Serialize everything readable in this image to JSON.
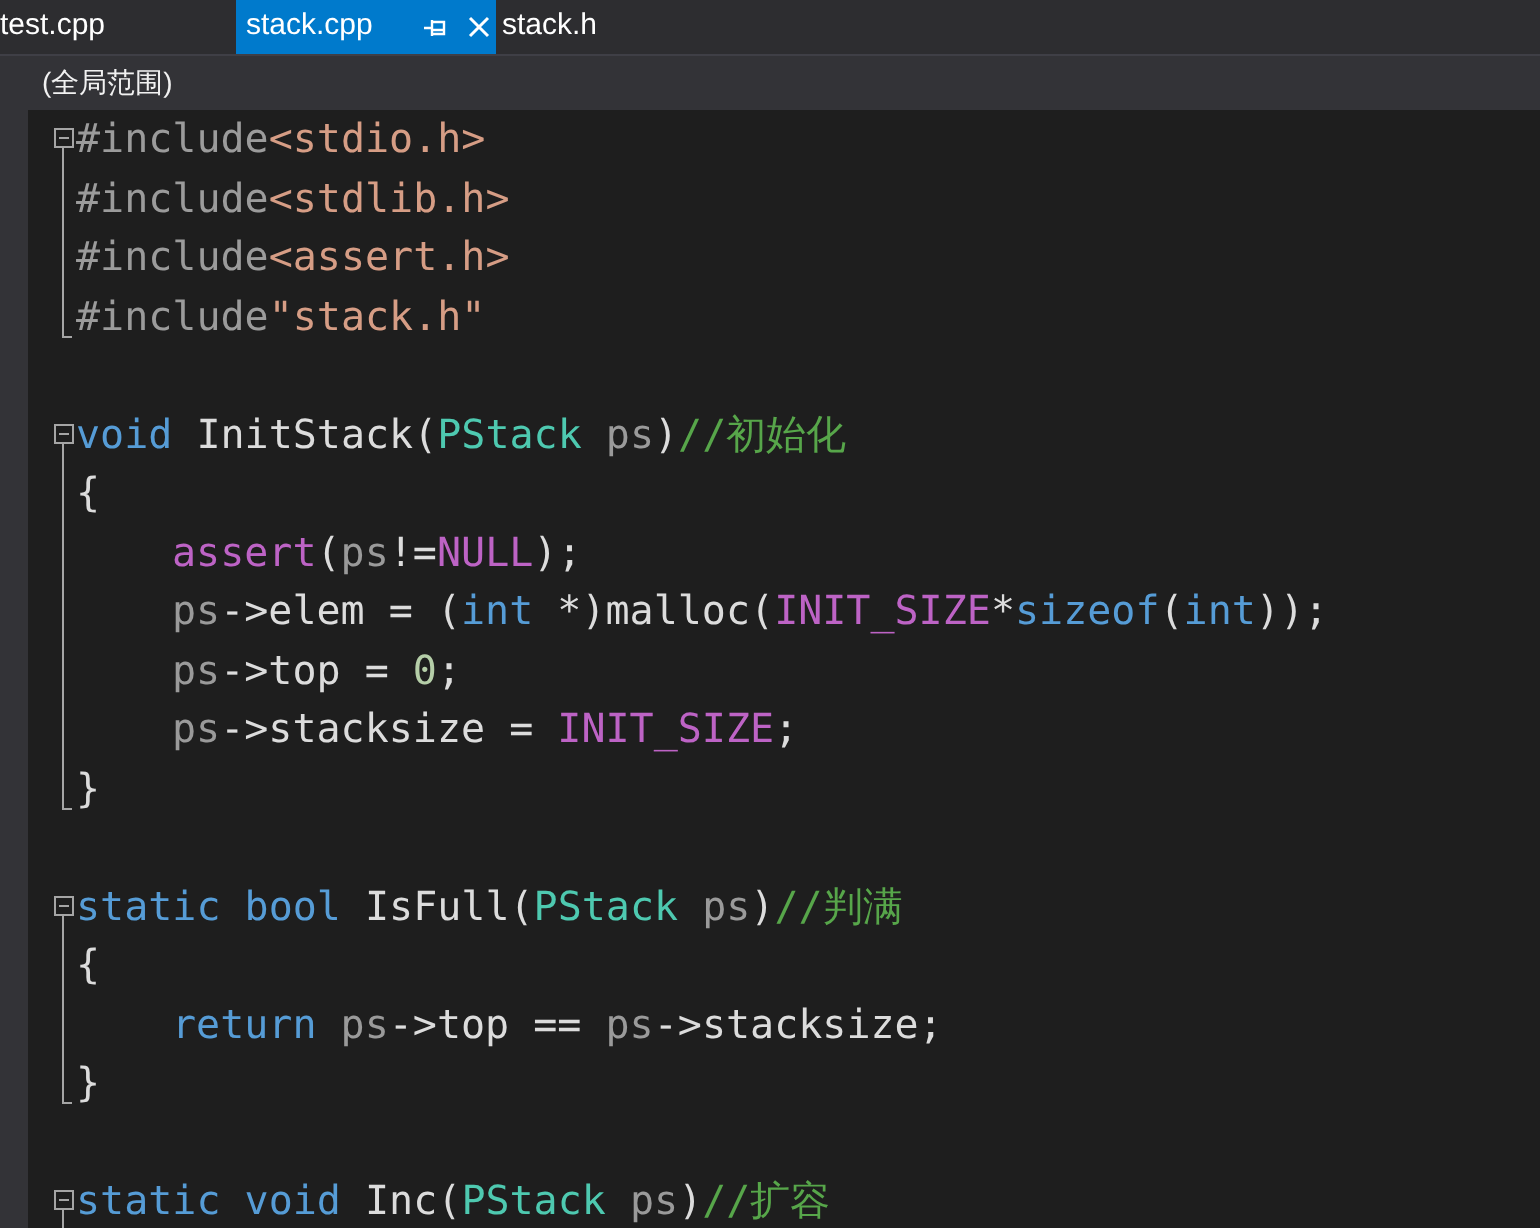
{
  "tabs": [
    {
      "label": "test.cpp",
      "selected": false
    },
    {
      "label": "stack.cpp",
      "selected": true
    },
    {
      "label": "stack.h",
      "selected": false
    }
  ],
  "scope": "(全局范围)",
  "code": [
    {
      "kind": "start",
      "tokens": [
        {
          "text": "#include",
          "kind": "pre"
        },
        {
          "text": "<stdio.h>",
          "kind": "str"
        }
      ]
    },
    {
      "kind": "inside",
      "tokens": [
        {
          "text": "#include",
          "kind": "pre"
        },
        {
          "text": "<stdlib.h>",
          "kind": "str"
        }
      ]
    },
    {
      "kind": "inside",
      "tokens": [
        {
          "text": "#include",
          "kind": "pre"
        },
        {
          "text": "<assert.h>",
          "kind": "str"
        }
      ]
    },
    {
      "kind": "end",
      "tokens": [
        {
          "text": "#include",
          "kind": "pre"
        },
        {
          "text": "\"stack.h\"",
          "kind": "str"
        }
      ]
    },
    {
      "kind": "blank"
    },
    {
      "kind": "start",
      "tokens": [
        {
          "text": "void",
          "kind": "kw"
        },
        {
          "text": " InitStack(",
          "kind": "plain"
        },
        {
          "text": "PStack",
          "kind": "type"
        },
        {
          "text": " ps",
          "kind": "param"
        },
        {
          "text": ")",
          "kind": "plain"
        },
        {
          "text": "//初始化",
          "kind": "comment"
        }
      ]
    },
    {
      "kind": "inside",
      "tokens": [
        {
          "text": "{",
          "kind": "plain"
        }
      ],
      "children": [
        {
          "kind": "inside",
          "tokens": [
            {
              "text": "assert",
              "kind": "macro"
            },
            {
              "text": "(",
              "kind": "plain"
            },
            {
              "text": "ps",
              "kind": "param"
            },
            {
              "text": "!=",
              "kind": "plain"
            },
            {
              "text": "NULL",
              "kind": "macro"
            },
            {
              "text": ");",
              "kind": "plain"
            }
          ]
        },
        {
          "kind": "inside",
          "tokens": [
            {
              "text": "ps",
              "kind": "param"
            },
            {
              "text": "->elem = (",
              "kind": "plain"
            },
            {
              "text": "int",
              "kind": "kw"
            },
            {
              "text": " *)malloc(",
              "kind": "plain"
            },
            {
              "text": "INIT_SIZE",
              "kind": "macro"
            },
            {
              "text": "*",
              "kind": "plain"
            },
            {
              "text": "sizeof",
              "kind": "kw"
            },
            {
              "text": "(",
              "kind": "plain"
            },
            {
              "text": "int",
              "kind": "kw"
            },
            {
              "text": "));",
              "kind": "plain"
            }
          ]
        },
        {
          "kind": "inside",
          "tokens": [
            {
              "text": "ps",
              "kind": "param"
            },
            {
              "text": "->top = ",
              "kind": "plain"
            },
            {
              "text": "0",
              "kind": "num"
            },
            {
              "text": ";",
              "kind": "plain"
            }
          ]
        },
        {
          "kind": "inside",
          "tokens": [
            {
              "text": "ps",
              "kind": "param"
            },
            {
              "text": "->stacksize = ",
              "kind": "plain"
            },
            {
              "text": "INIT_SIZE",
              "kind": "macro"
            },
            {
              "text": ";",
              "kind": "plain"
            }
          ]
        }
      ]
    },
    {
      "kind": "end",
      "tokens": [
        {
          "text": "}",
          "kind": "plain"
        }
      ]
    },
    {
      "kind": "blank"
    },
    {
      "kind": "start",
      "tokens": [
        {
          "text": "static ",
          "kind": "kw"
        },
        {
          "text": "bool",
          "kind": "kw"
        },
        {
          "text": " IsFull(",
          "kind": "plain"
        },
        {
          "text": "PStack",
          "kind": "type"
        },
        {
          "text": " ps",
          "kind": "param"
        },
        {
          "text": ")",
          "kind": "plain"
        },
        {
          "text": "//判满",
          "kind": "comment"
        }
      ]
    },
    {
      "kind": "inside",
      "tokens": [
        {
          "text": "{",
          "kind": "plain"
        }
      ],
      "children": [
        {
          "kind": "inside",
          "tokens": [
            {
              "text": "return ",
              "kind": "kw"
            },
            {
              "text": "ps",
              "kind": "param"
            },
            {
              "text": "->top == ",
              "kind": "plain"
            },
            {
              "text": "ps",
              "kind": "param"
            },
            {
              "text": "->stacksize;",
              "kind": "plain"
            }
          ]
        }
      ]
    },
    {
      "kind": "end",
      "tokens": [
        {
          "text": "}",
          "kind": "plain"
        }
      ]
    },
    {
      "kind": "blank"
    },
    {
      "kind": "start",
      "tokens": [
        {
          "text": "static ",
          "kind": "kw"
        },
        {
          "text": "void",
          "kind": "kw"
        },
        {
          "text": " Inc(",
          "kind": "plain"
        },
        {
          "text": "PStack",
          "kind": "type"
        },
        {
          "text": " ps",
          "kind": "param"
        },
        {
          "text": ")",
          "kind": "plain"
        },
        {
          "text": "//扩容",
          "kind": "comment"
        }
      ]
    }
  ]
}
